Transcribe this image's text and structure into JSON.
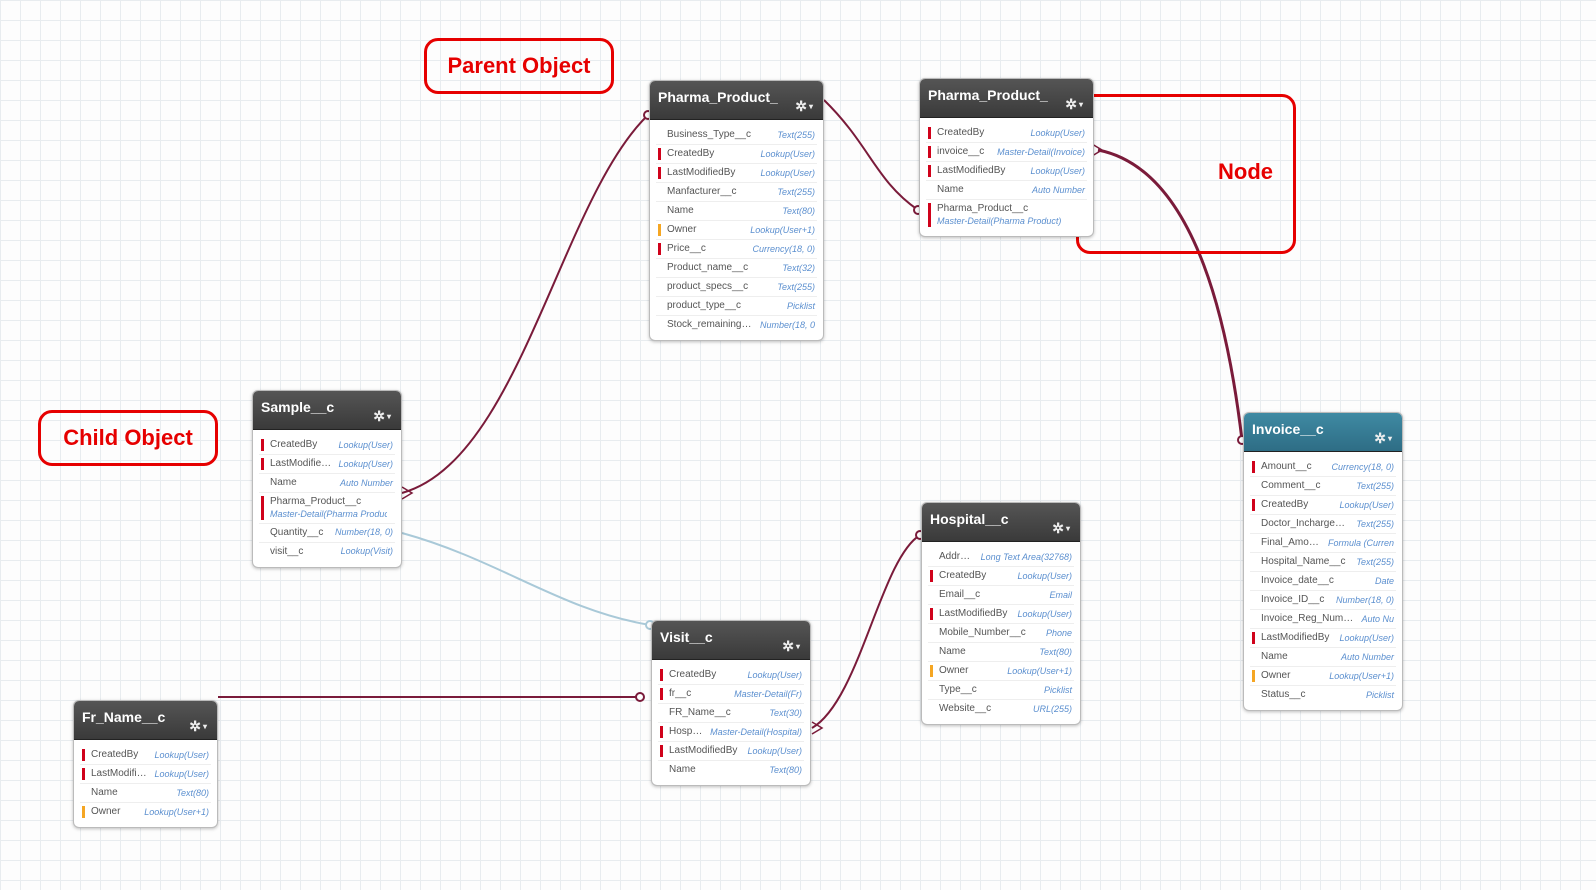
{
  "callouts": {
    "parent": "Parent Object",
    "child": "Child Object",
    "node": "Node"
  },
  "colors": {
    "annotation_red": "#e60000",
    "link_masterdetail": "#7a1b3a",
    "link_lookup": "#a9c9d8",
    "text_fieldtype": "#5b8fcf"
  },
  "entities": {
    "pharma_product_1": {
      "title": "Pharma_Product_",
      "fields": [
        {
          "name": "Business_Type__c",
          "type": "Text(255)",
          "flag": ""
        },
        {
          "name": "CreatedBy",
          "type": "Lookup(User)",
          "flag": "red"
        },
        {
          "name": "LastModifiedBy",
          "type": "Lookup(User)",
          "flag": "red"
        },
        {
          "name": "Manfacturer__c",
          "type": "Text(255)",
          "flag": ""
        },
        {
          "name": "Name",
          "type": "Text(80)",
          "flag": ""
        },
        {
          "name": "Owner",
          "type": "Lookup(User+1)",
          "flag": "orange"
        },
        {
          "name": "Price__c",
          "type": "Currency(18, 0)",
          "flag": "red"
        },
        {
          "name": "Product_name__c",
          "type": "Text(32)",
          "flag": ""
        },
        {
          "name": "product_specs__c",
          "type": "Text(255)",
          "flag": ""
        },
        {
          "name": "product_type__c",
          "type": "Picklist",
          "flag": ""
        },
        {
          "name": "Stock_remaining__c",
          "type": "Number(18, 0",
          "flag": ""
        }
      ]
    },
    "pharma_product_2": {
      "title": "Pharma_Product_",
      "fields": [
        {
          "name": "CreatedBy",
          "type": "Lookup(User)",
          "flag": "red"
        },
        {
          "name": "invoice__c",
          "type": "Master-Detail(Invoice)",
          "flag": "red"
        },
        {
          "name": "LastModifiedBy",
          "type": "Lookup(User)",
          "flag": "red"
        },
        {
          "name": "Name",
          "type": "Auto Number",
          "flag": ""
        },
        {
          "name": "Pharma_Product__c",
          "type": "",
          "sub": "Master-Detail(Pharma Product)",
          "flag": "red"
        }
      ]
    },
    "invoice": {
      "title": "Invoice__c",
      "fields": [
        {
          "name": "Amount__c",
          "type": "Currency(18, 0)",
          "flag": "red"
        },
        {
          "name": "Comment__c",
          "type": "Text(255)",
          "flag": ""
        },
        {
          "name": "CreatedBy",
          "type": "Lookup(User)",
          "flag": "red"
        },
        {
          "name": "Doctor_Incharge__c",
          "type": "Text(255)",
          "flag": ""
        },
        {
          "name": "Final_Amount__c",
          "type": "Formula (Curren",
          "flag": ""
        },
        {
          "name": "Hospital_Name__c",
          "type": "Text(255)",
          "flag": ""
        },
        {
          "name": "Invoice_date__c",
          "type": "Date",
          "flag": ""
        },
        {
          "name": "Invoice_ID__c",
          "type": "Number(18, 0)",
          "flag": ""
        },
        {
          "name": "Invoice_Reg_Number__c",
          "type": "Auto Nu",
          "flag": ""
        },
        {
          "name": "LastModifiedBy",
          "type": "Lookup(User)",
          "flag": "red"
        },
        {
          "name": "Name",
          "type": "Auto Number",
          "flag": ""
        },
        {
          "name": "Owner",
          "type": "Lookup(User+1)",
          "flag": "orange"
        },
        {
          "name": "Status__c",
          "type": "Picklist",
          "flag": ""
        }
      ]
    },
    "sample": {
      "title": "Sample__c",
      "fields": [
        {
          "name": "CreatedBy",
          "type": "Lookup(User)",
          "flag": "red"
        },
        {
          "name": "LastModifiedBy",
          "type": "Lookup(User)",
          "flag": "red"
        },
        {
          "name": "Name",
          "type": "Auto Number",
          "flag": ""
        },
        {
          "name": "Pharma_Product__c",
          "type": "",
          "sub": "Master-Detail(Pharma Product)",
          "flag": "red"
        },
        {
          "name": "Quantity__c",
          "type": "Number(18, 0)",
          "flag": ""
        },
        {
          "name": "visit__c",
          "type": "Lookup(Visit)",
          "flag": ""
        }
      ]
    },
    "fr_name": {
      "title": "Fr_Name__c",
      "fields": [
        {
          "name": "CreatedBy",
          "type": "Lookup(User)",
          "flag": "red"
        },
        {
          "name": "LastModifiedBy",
          "type": "Lookup(User)",
          "flag": "red"
        },
        {
          "name": "Name",
          "type": "Text(80)",
          "flag": ""
        },
        {
          "name": "Owner",
          "type": "Lookup(User+1)",
          "flag": "orange"
        }
      ]
    },
    "visit": {
      "title": "Visit__c",
      "fields": [
        {
          "name": "CreatedBy",
          "type": "Lookup(User)",
          "flag": "red"
        },
        {
          "name": "fr__c",
          "type": "Master-Detail(Fr)",
          "flag": "red"
        },
        {
          "name": "FR_Name__c",
          "type": "Text(30)",
          "flag": ""
        },
        {
          "name": "Hospital__c",
          "type": "Master-Detail(Hospital)",
          "flag": "red"
        },
        {
          "name": "LastModifiedBy",
          "type": "Lookup(User)",
          "flag": "red"
        },
        {
          "name": "Name",
          "type": "Text(80)",
          "flag": ""
        }
      ]
    },
    "hospital": {
      "title": "Hospital__c",
      "fields": [
        {
          "name": "Address__c",
          "type": "Long Text Area(32768)",
          "flag": ""
        },
        {
          "name": "CreatedBy",
          "type": "Lookup(User)",
          "flag": "red"
        },
        {
          "name": "Email__c",
          "type": "Email",
          "flag": ""
        },
        {
          "name": "LastModifiedBy",
          "type": "Lookup(User)",
          "flag": "red"
        },
        {
          "name": "Mobile_Number__c",
          "type": "Phone",
          "flag": ""
        },
        {
          "name": "Name",
          "type": "Text(80)",
          "flag": ""
        },
        {
          "name": "Owner",
          "type": "Lookup(User+1)",
          "flag": "orange"
        },
        {
          "name": "Type__c",
          "type": "Picklist",
          "flag": ""
        },
        {
          "name": "Website__c",
          "type": "URL(255)",
          "flag": ""
        }
      ]
    }
  }
}
